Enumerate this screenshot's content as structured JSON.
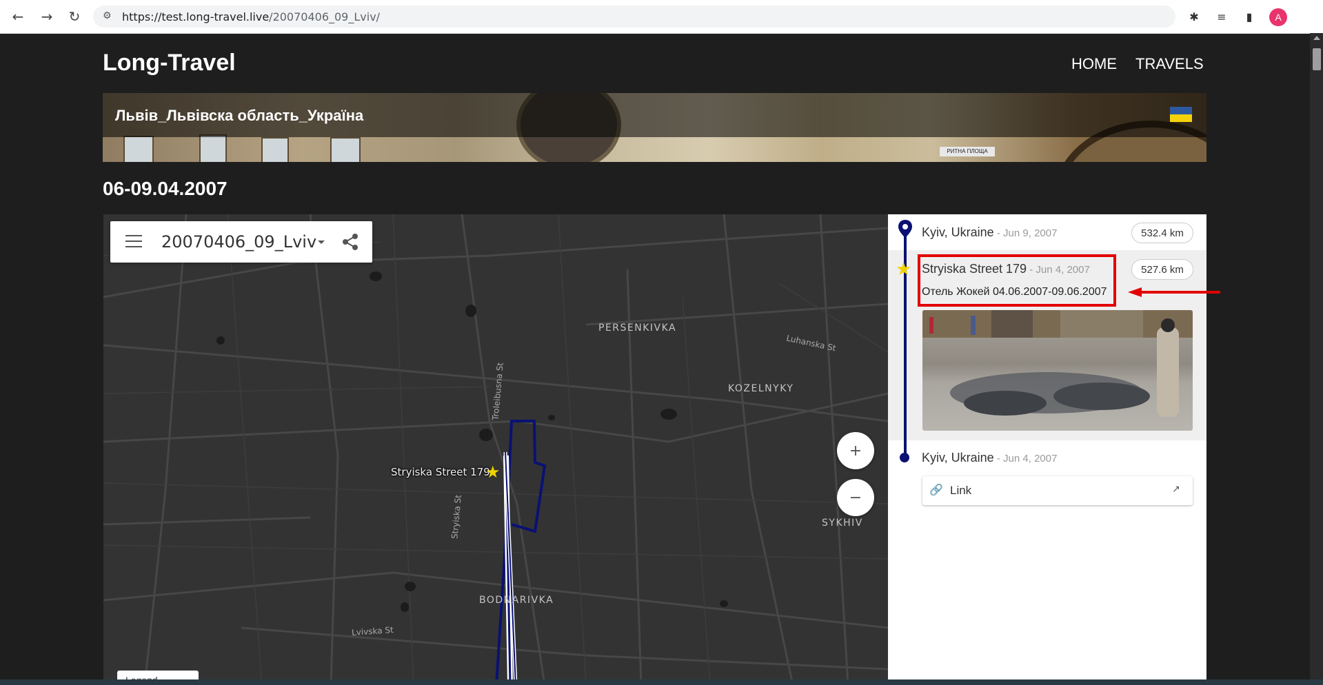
{
  "browser": {
    "url_host": "https://test.long-travel.live",
    "url_path": "/20070406_09_Lviv/",
    "avatar_letter": "A"
  },
  "site": {
    "title": "Long-Travel",
    "nav": [
      "HOME",
      "TRAVELS"
    ]
  },
  "banner": {
    "title": "Львів_Львівска область_Україна",
    "flag": "ukraine-flag",
    "sign_text": "РИТНА ПЛОЩА"
  },
  "page": {
    "dates": "06-09.04.2007"
  },
  "map": {
    "name": "20070406_09_Lviv",
    "zoom_in": "+",
    "zoom_out": "−",
    "legend": "Legend",
    "pin_label": "Stryiska Street 179",
    "districts": [
      "PERSENKIVKA",
      "KOZELNYKY",
      "SYKHIV",
      "BODNARIVKA"
    ],
    "streets": [
      "Luhanska St",
      "Troleibusna St",
      "Stryiska St",
      "Lvivska St"
    ]
  },
  "timeline": {
    "entries": [
      {
        "place": "Kyiv, Ukraine",
        "date": " - Jun 9, 2007",
        "distance": "532.4 km"
      },
      {
        "place": "Stryiska Street 179",
        "date": " - Jun 4, 2007",
        "distance": "527.6 km",
        "note": "Отель Жокей 04.06.2007-09.06.2007"
      },
      {
        "place": "Kyiv, Ukraine",
        "date": " - Jun 4, 2007"
      }
    ],
    "link_label": "Link"
  },
  "colors": {
    "route": "#0a1172",
    "star": "#f1d200",
    "annotation": "#e30000"
  }
}
